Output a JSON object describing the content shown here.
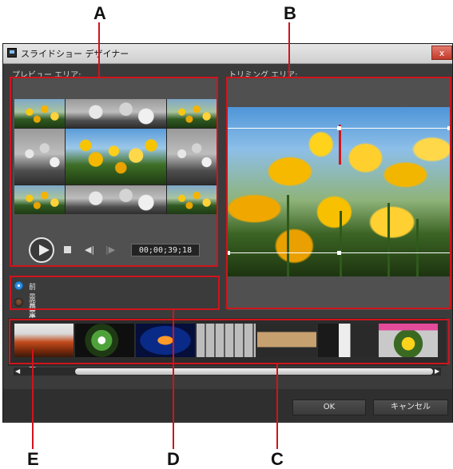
{
  "window": {
    "title": "スライドショー デザイナー",
    "close_label": "x"
  },
  "sections": {
    "preview_label": "プレビュー エリア:",
    "trimming_label": "トリミング エリア:"
  },
  "player": {
    "timecode": "00;00;39;18"
  },
  "edit_options": [
    {
      "label": "前景画像の編集",
      "selected": true
    },
    {
      "label": "背景画像の編集",
      "selected": false
    }
  ],
  "filmstrip": {
    "thumbnails": [
      "canyon",
      "flower",
      "jellyfish",
      "film-strip-gray",
      "desert-tiles",
      "penguins",
      "tulips-collage"
    ]
  },
  "buttons": {
    "ok": "OK",
    "cancel": "キャンセル"
  },
  "callouts": {
    "a": "A",
    "b": "B",
    "c": "C",
    "d": "D",
    "e": "E"
  },
  "colors": {
    "callout_red": "#d0141c",
    "radio_selected": "#2f8fe0",
    "window_bg": "#3b3b3b"
  }
}
